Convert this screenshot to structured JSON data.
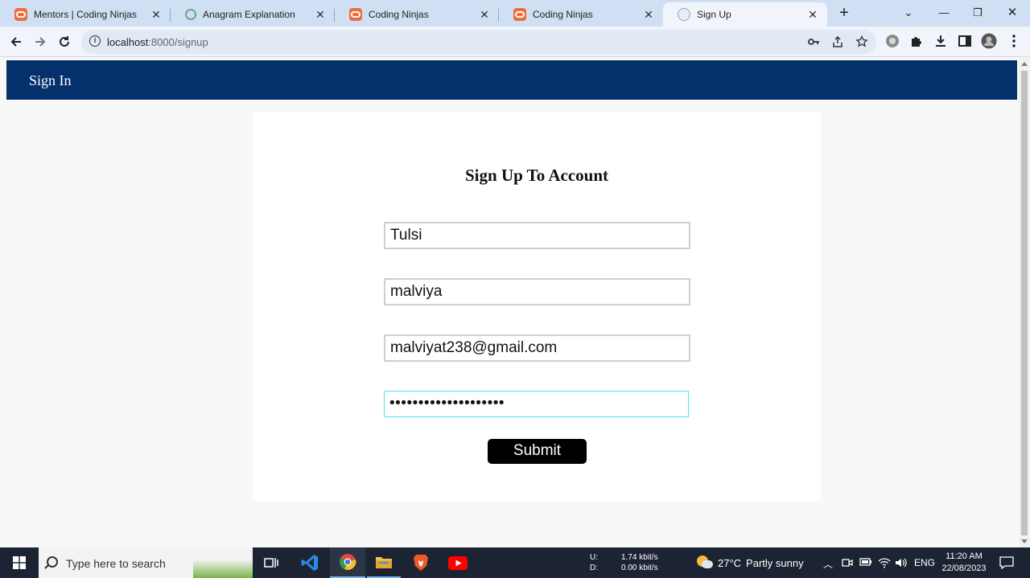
{
  "browser": {
    "tabs": [
      {
        "title": "Mentors | Coding Ninjas",
        "icon": "coding-ninjas-icon"
      },
      {
        "title": "Anagram Explanation",
        "icon": "chatgpt-icon"
      },
      {
        "title": "Coding Ninjas",
        "icon": "coding-ninjas-icon"
      },
      {
        "title": "Coding Ninjas",
        "icon": "coding-ninjas-icon"
      },
      {
        "title": "Sign Up",
        "icon": "globe-icon",
        "active": true
      }
    ],
    "url_host": "localhost",
    "url_path": ":8000/signup"
  },
  "page": {
    "nav": {
      "signin_label": "Sign In"
    },
    "form": {
      "heading": "Sign Up To Account",
      "first_name": "Tulsi",
      "last_name": "malviya",
      "email": "malviyat238@gmail.com",
      "password_mask": "••••••••••••••••••••",
      "submit_label": "Submit"
    }
  },
  "taskbar": {
    "search_placeholder": "Type here to search",
    "net_upload_label": "U:",
    "net_download_label": "D:",
    "net_upload": "1.74 kbit/s",
    "net_download": "0.00 kbit/s",
    "weather_temp": "27°C",
    "weather_desc": "Partly sunny",
    "lang": "ENG",
    "time": "11:20 AM",
    "date": "22/08/2023"
  },
  "colors": {
    "navbar": "#04306b",
    "focus_border": "#50e6e6",
    "submit_bg": "#000000"
  }
}
